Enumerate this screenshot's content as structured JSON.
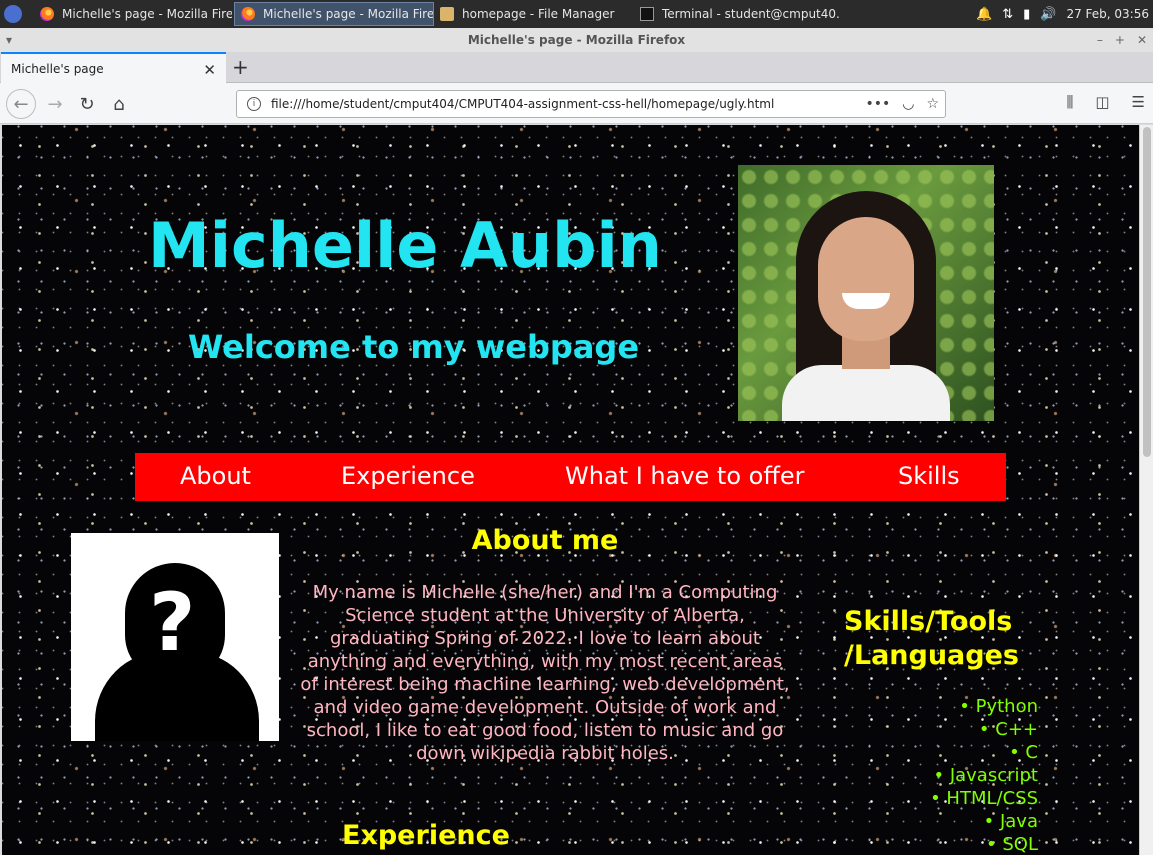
{
  "taskbar": {
    "tasks": [
      {
        "label": "Michelle's page - Mozilla Fire...",
        "icon": "firefox-icon",
        "active": false
      },
      {
        "label": "Michelle's page - Mozilla Fire...",
        "icon": "firefox-icon",
        "active": true
      },
      {
        "label": "homepage - File Manager",
        "icon": "folder-icon",
        "active": false
      },
      {
        "label": "Terminal - student@cmput40...",
        "icon": "terminal-icon",
        "active": false
      }
    ],
    "clock": "27 Feb, 03:56"
  },
  "window": {
    "title": "Michelle's page - Mozilla Firefox"
  },
  "browser": {
    "tab_title": "Michelle's page",
    "url": "file:///home/student/cmput404/CMPUT404-assignment-css-hell/homepage/ugly.html"
  },
  "page": {
    "name": "Michelle Aubin",
    "welcome": "Welcome to my webpage",
    "nav": [
      "About",
      "Experience",
      "What I have to offer",
      "Skills"
    ],
    "about_title": "About me",
    "about_text": "My name is Michelle (she/her) and I'm a Computing Science student at the University of Alberta, graduating Spring of 2022. I love to learn about anything and everything, with my most recent areas of interest being machine learning, web development, and video game development. Outside of work and school, I like to eat good food, listen to music and go down wikipedia rabbit holes.",
    "skills_title": "Skills/Tools /Languages",
    "skills": [
      "Python",
      "C++",
      "C",
      "Javascript",
      "HTML/CSS",
      "Java",
      "SQL"
    ],
    "experience_title": "Experience"
  },
  "colors": {
    "heading_cyan": "#23e5f2",
    "nav_red": "#ff0000",
    "section_yellow": "#ffff00",
    "about_pink": "#ffb6c1",
    "skills_green": "#7fff00"
  }
}
